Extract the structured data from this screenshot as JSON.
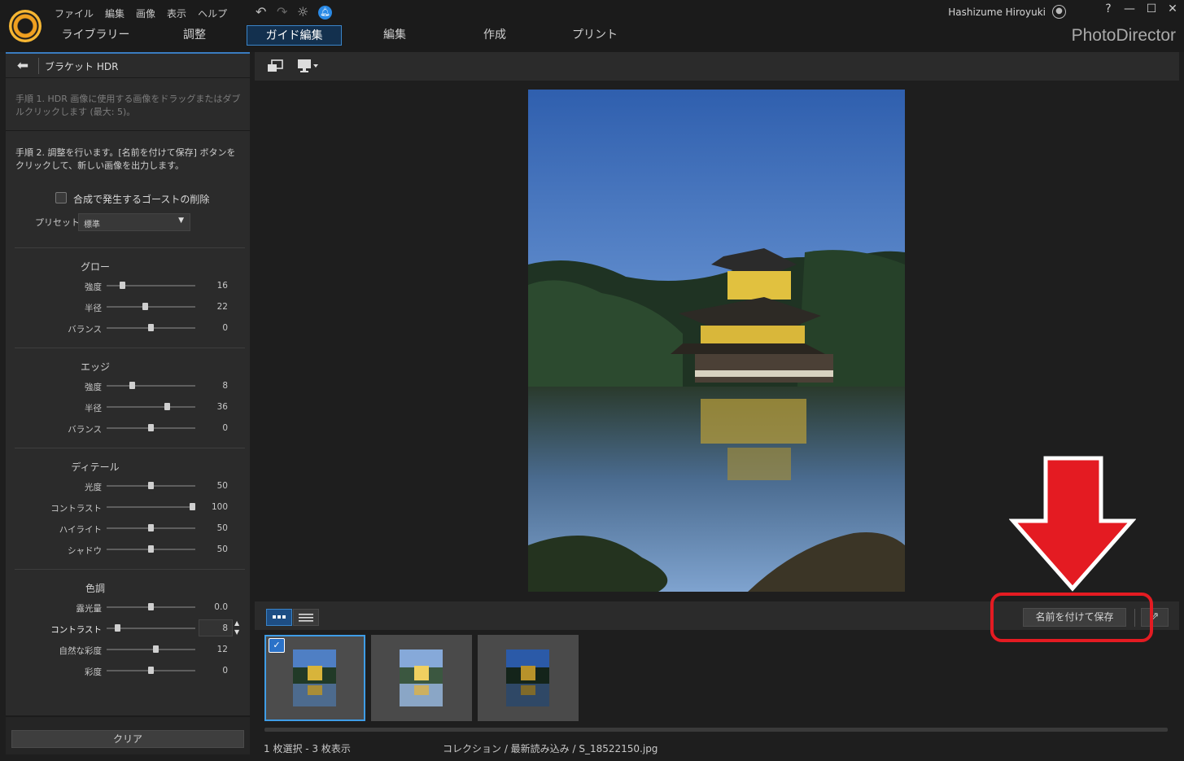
{
  "menu": [
    "ファイル",
    "編集",
    "画像",
    "表示",
    "ヘルプ"
  ],
  "titlebar": {
    "user": "Hashizume Hiroyuki",
    "brand": "PhotoDirector",
    "help": "?",
    "minimize": "—",
    "maximize": "☐",
    "close": "✕"
  },
  "tabs": [
    {
      "label": "ライブラリー",
      "active": false
    },
    {
      "label": "調整",
      "active": false
    },
    {
      "label": "ガイド編集",
      "active": true
    },
    {
      "label": "編集",
      "active": false
    },
    {
      "label": "作成",
      "active": false
    },
    {
      "label": "プリント",
      "active": false
    }
  ],
  "panel": {
    "title": "ブラケット HDR",
    "step1": "手順 1. HDR 画像に使用する画像をドラッグまたはダブルクリックします (最大: 5)。",
    "step2": "手順 2. 調整を行います。[名前を付けて保存] ボタンをクリックして、新しい画像を出力します。",
    "ghost_removal_label": "合成で発生するゴーストの削除",
    "ghost_removal_checked": false,
    "preset_label": "プリセット",
    "preset_value": "標準",
    "groups": [
      {
        "title": "グロー",
        "sliders": [
          {
            "label": "強度",
            "value": "16",
            "pos": 0.16
          },
          {
            "label": "半径",
            "value": "22",
            "pos": 0.43
          },
          {
            "label": "バランス",
            "value": "0",
            "pos": 0.5
          }
        ]
      },
      {
        "title": "エッジ",
        "sliders": [
          {
            "label": "強度",
            "value": "8",
            "pos": 0.27
          },
          {
            "label": "半径",
            "value": "36",
            "pos": 0.7
          },
          {
            "label": "バランス",
            "value": "0",
            "pos": 0.5
          }
        ]
      },
      {
        "title": "ディテール",
        "sliders": [
          {
            "label": "光度",
            "value": "50",
            "pos": 0.5
          },
          {
            "label": "コントラスト",
            "value": "100",
            "pos": 1.0
          },
          {
            "label": "ハイライト",
            "value": "50",
            "pos": 0.5
          },
          {
            "label": "シャドウ",
            "value": "50",
            "pos": 0.5
          }
        ]
      },
      {
        "title": "色調",
        "sliders": [
          {
            "label": "露光量",
            "value": "0.0",
            "pos": 0.5
          },
          {
            "label": "コントラスト",
            "value": "8",
            "pos": 0.1
          },
          {
            "label": "自然な彩度",
            "value": "12",
            "pos": 0.56
          },
          {
            "label": "彩度",
            "value": "0",
            "pos": 0.5
          }
        ]
      }
    ],
    "clear_label": "クリア"
  },
  "filmstrip": {
    "save_as_label": "名前を付けて保存",
    "thumbnails": [
      "S_18522150.jpg (selected)",
      "bracket-2",
      "bracket-3"
    ]
  },
  "status": {
    "selection": "1 枚選択 - 3 枚表示",
    "path": "コレクション / 最新読み込み / S_18522150.jpg"
  },
  "colors": {
    "accent": "#3a84c8",
    "annotation": "#e41b22",
    "panel": "#2b2b2b",
    "background": "#1e1e1e"
  },
  "icons": [
    "app-logo-icon",
    "undo-icon",
    "redo-icon",
    "settings-icon",
    "notification-icon",
    "user-icon",
    "back-arrow-icon",
    "compare-view-icon",
    "display-icon",
    "thumbnail-view-icon",
    "list-view-icon",
    "export-icon",
    "hdr-badge-icon"
  ]
}
